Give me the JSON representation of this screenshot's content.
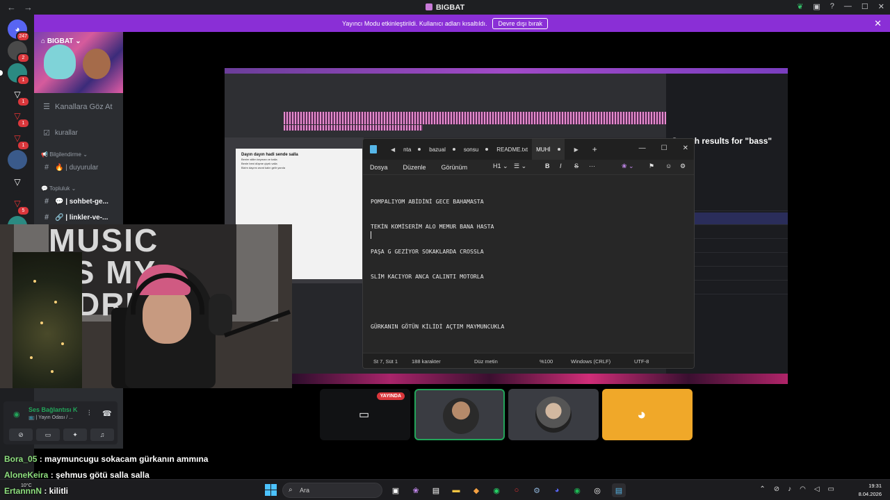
{
  "window": {
    "title": "BIGBAT"
  },
  "banner": {
    "message": "Yayıncı Modu etkinleştirildi. Kullanıcı adları kısaltıldı.",
    "button_label": "Devre dışı bırak"
  },
  "rail": {
    "home_badge": "247",
    "badges": [
      "2",
      "1",
      "1",
      "1",
      "1",
      "1",
      "5",
      "1"
    ]
  },
  "server": {
    "name": "BIGBAT",
    "browse_label": "Kanallara Göz At",
    "channels": [
      {
        "icon": "check-square",
        "label": "kurallar"
      },
      {
        "icon": "hash",
        "label": "🔥 | duyurular"
      },
      {
        "icon": "hash",
        "label": "💬 | sohbet-ge..."
      },
      {
        "icon": "hash",
        "label": "🔗 | linkler-ve-..."
      }
    ],
    "categories": [
      "Bilgilendirme",
      "Topluluk"
    ]
  },
  "voice": {
    "status": "Ses Bağlantısı K",
    "subtitle": "📺 | Yayın Odası / ..."
  },
  "share": {
    "search_title": "Search results for \"bass\"",
    "paper_title": "Dayın dayın hadi sende salla",
    "paper_lines": [
      "Benim stilim keyman ve balla",
      "Benle beni düşme çiçek valla",
      "Bizim dayımı avrat kalın gelir yanıla"
    ]
  },
  "notepad": {
    "tabs": [
      "nta",
      "bazual",
      "sonsu",
      "README.txt",
      "MUHİ"
    ],
    "active_tab": "MUHİ",
    "menu": [
      "Dosya",
      "Düzenle",
      "Görünüm"
    ],
    "format": "H1",
    "lines": [
      "POMPALIYOM ABİDİNİ GECE BAHAMASTA",
      "TEKİN KOMİSERİM ALO MEMUR BANA HASTA",
      "PAŞA G GEZİYOR SOKAKLARDA CROSSLA",
      "SLİM KACIYOR ANCA CALINTI MOTORLA",
      "",
      "GÜRKANIN GÖTÜN KİLİDİ AÇTIM MAYMUNCUKLA"
    ],
    "status": {
      "position": "St 7, Süt 1",
      "chars": "188 karakter",
      "mode": "Düz metin",
      "zoom": "%100",
      "eol": "Windows (CRLF)",
      "encoding": "UTF-8"
    }
  },
  "webcam": {
    "poster": [
      "MUSIC",
      "IS MY",
      "DRU"
    ]
  },
  "tiles": {
    "live_label": "YAYINDA"
  },
  "chat": [
    {
      "user": "Bora_05",
      "text": ": maymuncugu sokacam gürkanın ammına"
    },
    {
      "user": "AloneKeira",
      "text": ": şehmus götü salla salla"
    },
    {
      "user": "ErtannnN",
      "text": ": kilitli"
    }
  ],
  "taskbar": {
    "weather": "10°C",
    "search_placeholder": "Ara",
    "time": "19:31",
    "date": "8.04.2026"
  },
  "colors": {
    "discord_accent": "#5865f2",
    "banner": "#8a2fd6",
    "live_red": "#da373c",
    "voice_green": "#23a55a"
  }
}
